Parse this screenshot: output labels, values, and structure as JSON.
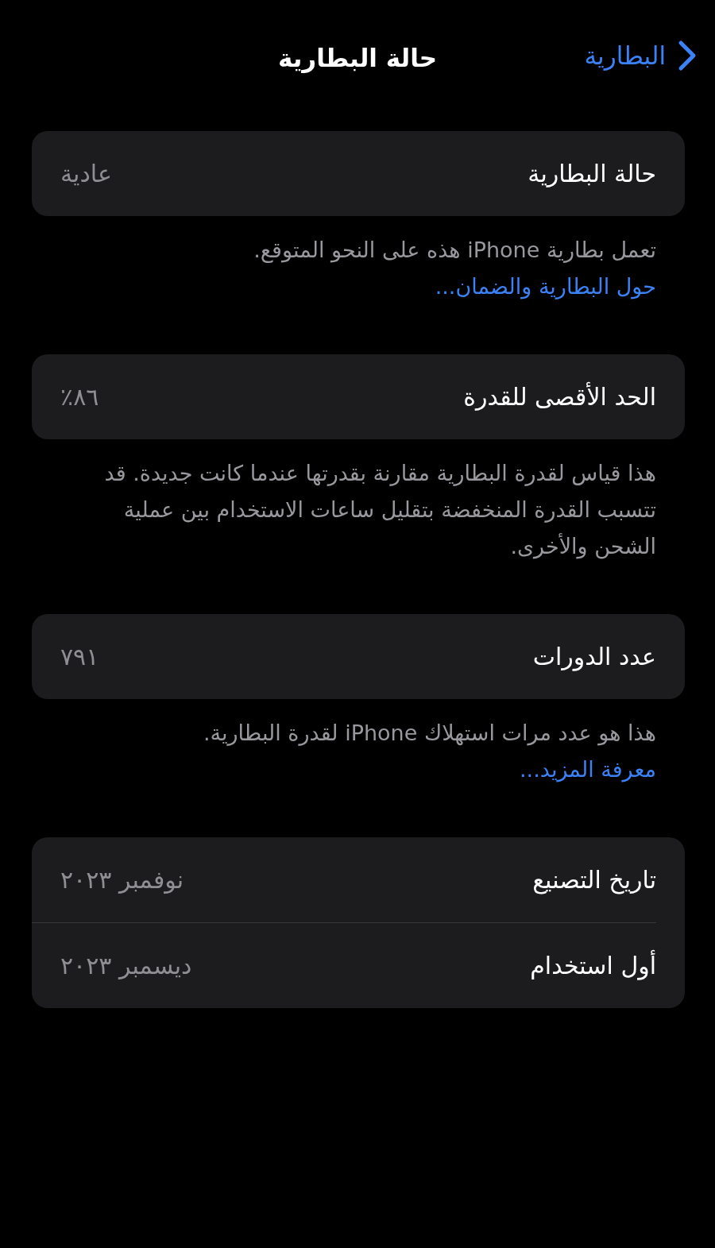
{
  "nav": {
    "back_label": "البطارية",
    "title": "حالة البطارية"
  },
  "sections": [
    {
      "rows": [
        {
          "label": "حالة البطارية",
          "value": "عادية"
        }
      ],
      "footer": {
        "text": "تعمل بطارية iPhone هذه على النحو المتوقع.",
        "link": "حول البطارية والضمان..."
      }
    },
    {
      "rows": [
        {
          "label": "الحد الأقصى للقدرة",
          "value": "٨٦٪"
        }
      ],
      "footer": {
        "text": "هذا قياس لقدرة البطارية مقارنة بقدرتها عندما كانت جديدة. قد تتسبب القدرة المنخفضة بتقليل ساعات الاستخدام بين عملية الشحن والأخرى."
      }
    },
    {
      "rows": [
        {
          "label": "عدد الدورات",
          "value": "٧٩١"
        }
      ],
      "footer": {
        "text": "هذا هو عدد مرات استهلاك iPhone لقدرة البطارية.",
        "link": "معرفة المزيد...",
        "link_on_new_line": true
      }
    },
    {
      "rows": [
        {
          "label": "تاريخ التصنيع",
          "value": "نوفمبر ٢٠٢٣"
        },
        {
          "label": "أول استخدام",
          "value": "ديسمبر ٢٠٢٣"
        }
      ]
    }
  ]
}
